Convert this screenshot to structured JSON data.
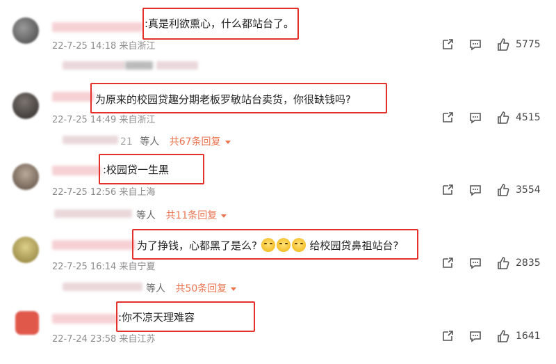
{
  "comments": [
    {
      "text": ":真是利欲熏心，什么都站台了。",
      "time": "22-7-25 14:18",
      "location": "来自浙江",
      "likes": "5775",
      "avatar_color": "#6b6b6b"
    },
    {
      "text": "为原来的校园贷趣分期老板罗敏站台卖货，你很缺钱吗?",
      "time": "22-7-25 14:49",
      "location": "来自浙江",
      "likes": "4515",
      "reply_partial": "21",
      "reply_people": "等人",
      "reply_total": "共67条回复",
      "avatar_color": "#55504c"
    },
    {
      "text": ":校园贷一生黑",
      "time": "22-7-25 12:56",
      "location": "来自上海",
      "likes": "3554",
      "reply_people": "等人",
      "reply_total": "共11条回复",
      "avatar_color": "#8a7d73"
    },
    {
      "text_a": "为了挣钱，心都黑了是么?",
      "text_b": "给校园贷鼻祖站台?",
      "time": "22-7-25 16:14",
      "location": "来自宁夏",
      "likes": "2835",
      "reply_people": "等人",
      "reply_total": "共50条回复",
      "avatar_color": "#c9b46a"
    },
    {
      "text": ":你不凉天理难容",
      "time": "22-7-24 23:58",
      "location": "来自江苏",
      "likes": "1641",
      "avatar_color": "#e0584a"
    }
  ],
  "colors": {
    "highlight": "#e5312c",
    "reply_link": "#eb7350",
    "meta": "#8c8c8c"
  },
  "icons": [
    "share-icon",
    "comment-icon",
    "like-icon"
  ]
}
